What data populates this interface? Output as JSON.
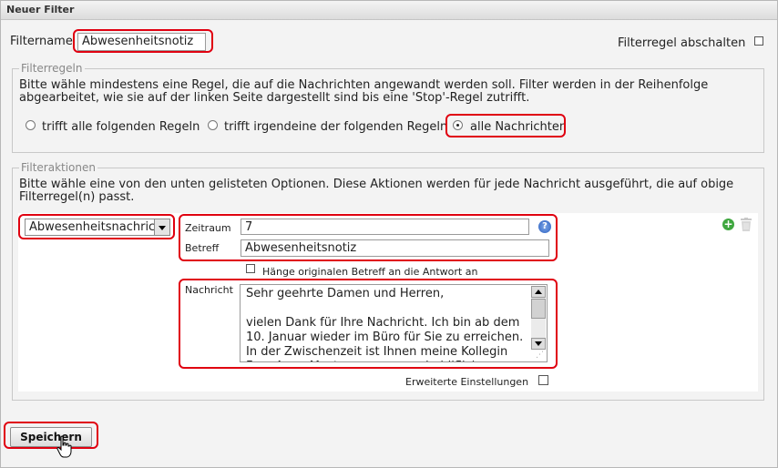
{
  "window": {
    "title": "Neuer Filter"
  },
  "filtername": {
    "label": "Filtername",
    "value": "Abwesenheitsnotiz"
  },
  "disable_rule": {
    "label": "Filterregel abschalten",
    "checked": false
  },
  "rules": {
    "legend": "Filterregeln",
    "description_line1": "Bitte wähle mindestens eine Regel, die auf die Nachrichten angewandt werden soll. Filter werden in der Reihenfolge",
    "description_line2": "abgearbeitet, wie sie auf der linken Seite dargestellt sind bis eine 'Stop'-Regel zutrifft.",
    "options": [
      {
        "label": "trifft alle folgenden Regeln",
        "selected": false
      },
      {
        "label": "trifft irgendeine der folgenden Regeln",
        "selected": false
      },
      {
        "label": "alle Nachrichten",
        "selected": true
      }
    ]
  },
  "actions": {
    "legend": "Filteraktionen",
    "description_line1": "Bitte wähle eine von den unten gelisteten Optionen. Diese Aktionen werden für jede Nachricht ausgeführt, die auf obige",
    "description_line2": "Filterregel(n) passt.",
    "action_select_value": "Abwesenheitsnachricht",
    "period_label": "Zeitraum",
    "period_value": "7",
    "subject_label": "Betreff",
    "subject_value": "Abwesenheitsnotiz",
    "append_subject_label": "Hänge originalen Betreff an die Antwort an",
    "append_subject_checked": false,
    "message_label": "Nachricht",
    "message_value": "Sehr geehrte Damen und Herren,\n\nvielen Dank für Ihre Nachricht. Ich bin ab dem\n10. Januar wieder im Büro für Sie zu erreichen.\nIn der Zwischenzeit ist Ihnen meine Kollegin\nFrau Anne Mustermann gerne behilflich:",
    "advanced_label": "Erweiterte Einstellungen",
    "advanced_checked": false,
    "help_icon": "help-icon",
    "add_icon": "plus-icon",
    "delete_icon": "trash-icon"
  },
  "save_button": {
    "label": "Speichern"
  },
  "colors": {
    "highlight": "#e00010",
    "background": "#f3f3f3"
  }
}
